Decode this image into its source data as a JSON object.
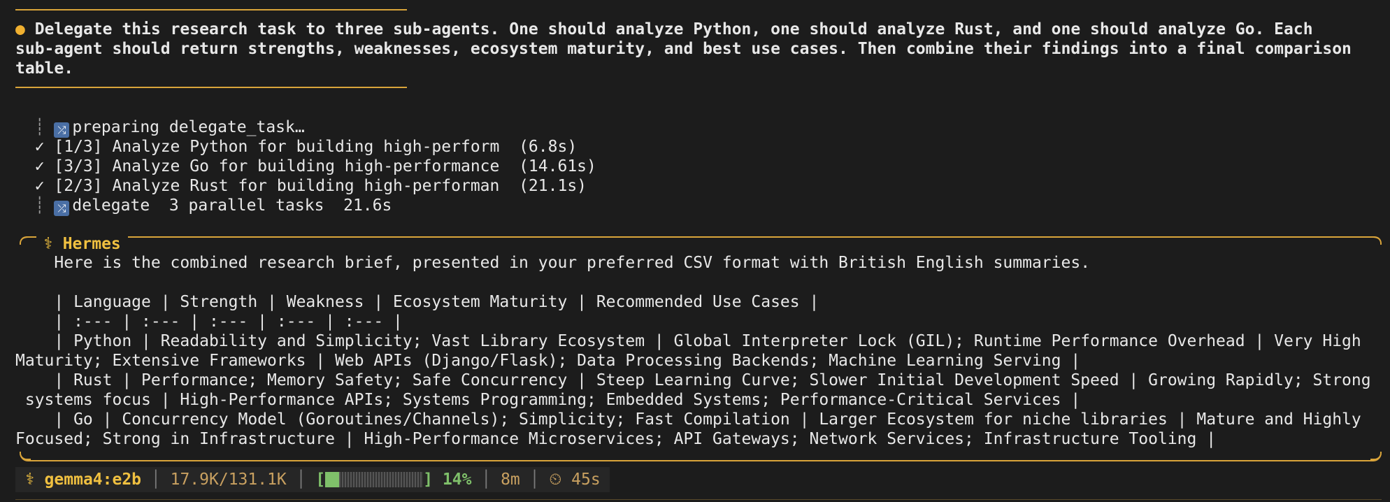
{
  "prompt": {
    "line1": "Delegate this research task to three sub-agents. One should analyze Python, one should analyze Rust, and one should analyze Go. Each",
    "line2": "sub-agent should return strengths, weaknesses, ecosystem maturity, and best use cases. Then combine their findings into a final comparison",
    "line3": "table."
  },
  "tools": {
    "preparing": "preparing delegate_task…",
    "tasks": [
      {
        "label": "[1/3] Analyze Python for building high-perform",
        "time": "(6.8s)"
      },
      {
        "label": "[3/3] Analyze Go for building high-performance",
        "time": "(14.61s)"
      },
      {
        "label": "[2/3] Analyze Rust for building high-performan",
        "time": "(21.1s)"
      }
    ],
    "summary": "delegate  3 parallel tasks  21.6s"
  },
  "response": {
    "agent": "⚕ Hermes",
    "intro": "Here is the combined research brief, presented in your preferred CSV format with British English summaries.",
    "lines": [
      "    | Language | Strength | Weakness | Ecosystem Maturity | Recommended Use Cases |",
      "    | :--- | :--- | :--- | :--- | :--- |",
      "    | Python | Readability and Simplicity; Vast Library Ecosystem | Global Interpreter Lock (GIL); Runtime Performance Overhead | Very High",
      "Maturity; Extensive Frameworks | Web APIs (Django/Flask); Data Processing Backends; Machine Learning Serving |",
      "    | Rust | Performance; Memory Safety; Safe Concurrency | Steep Learning Curve; Slower Initial Development Speed | Growing Rapidly; Strong",
      " systems focus | High-Performance APIs; Systems Programming; Embedded Systems; Performance-Critical Services |",
      "    | Go | Concurrency Model (Goroutines/Channels); Simplicity; Fast Compilation | Larger Ecosystem for niche libraries | Mature and Highly",
      "Focused; Strong in Infrastructure | High-Performance Microservices; API Gateways; Network Services; Infrastructure Tooling |"
    ]
  },
  "status": {
    "model": "⚕ gemma4:e2b",
    "tokens": "17.9K/131.1K",
    "progress_fraction": 0.14,
    "percent": "14%",
    "elapsed": "8m",
    "timer": "⏲ 45s"
  }
}
